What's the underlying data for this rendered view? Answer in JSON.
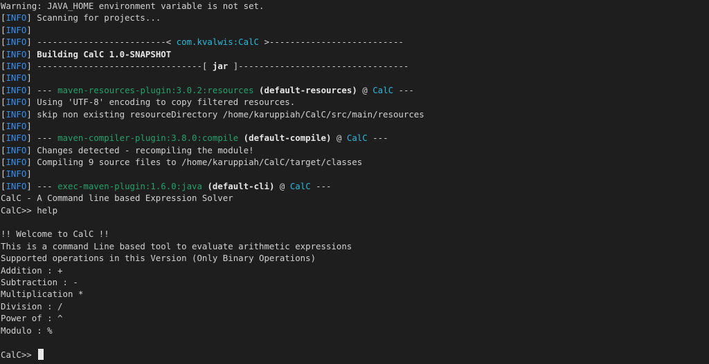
{
  "colors": {
    "background": "#1e1e1e",
    "foreground": "#d2d2d2",
    "info": "#3b8eea",
    "cyan": "#29b8db",
    "green": "#23a26a"
  },
  "level": "INFO",
  "lines": {
    "warning": "Warning: JAVA_HOME environment variable is not set.",
    "scanning": " Scanning for projects...",
    "sep_left": " -------------------------< ",
    "artifact": "com.kvalwis:CalC",
    "sep_right": " >--------------------------",
    "building": "Building CalC 1.0-SNAPSHOT",
    "jar_sep_left": " --------------------------------[ ",
    "jar": "jar",
    "jar_sep_right": " ]---------------------------------",
    "dash3": " --- ",
    "at": " @ ",
    "trail": " ---",
    "resources_plugin": "maven-resources-plugin:3.0.2:resources",
    "resources_exec": "(default-resources)",
    "project": "CalC",
    "using_utf8": " Using 'UTF-8' encoding to copy filtered resources.",
    "skip_resource": " skip non existing resourceDirectory /home/karuppiah/CalC/src/main/resources",
    "compiler_plugin": "maven-compiler-plugin:3.8.0:compile",
    "compiler_exec": "(default-compile)",
    "changes": " Changes detected - recompiling the module!",
    "compiling": " Compiling 9 source files to /home/karuppiah/CalC/target/classes",
    "exec_plugin": "exec-maven-plugin:1.6.0:java",
    "exec_exec": "(default-cli)",
    "banner": "CalC - A Command line based Expression Solver",
    "prompt_help": "CalC>> help",
    "welcome": "!! Welcome to CalC !!",
    "desc": "This is a command Line based tool to evaluate arithmetic expressions",
    "supported": "Supported operations in this Version (Only Binary Operations)",
    "op_add": "Addition : +",
    "op_sub": "Subtraction : -",
    "op_mul": "Multiplication *",
    "op_div": "Division : /",
    "op_pow": "Power of : ^",
    "op_mod": "Modulo : %",
    "prompt": "CalC>> "
  }
}
